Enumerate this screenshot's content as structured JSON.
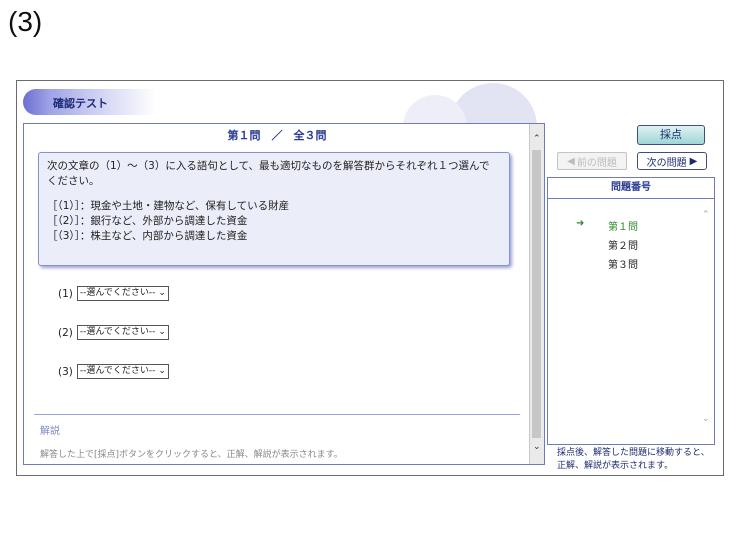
{
  "figure_label": "(3)",
  "header": {
    "title": "確認テスト"
  },
  "question": {
    "heading": "第１問　／　全３問",
    "prompt_line1": "次の文章の（1）～（3）に入る語句として、最も適切なものを解答群からそれぞれ１つ選んで",
    "prompt_line2": "ください。",
    "items": [
      "［（1）］：現金や土地・建物など、保有している財産",
      "［（2）］：銀行など、外部から調達した資金",
      "［（3）］：株主など、内部から調達した資金"
    ]
  },
  "answers": [
    {
      "label": "(1)",
      "value": "--選んでください--"
    },
    {
      "label": "(2)",
      "value": "--選んでください--"
    },
    {
      "label": "(3)",
      "value": "--選んでください--"
    }
  ],
  "explanation": {
    "title": "解説",
    "text": "解答した上で[採点]ボタンをクリックすると、正解、解説が表示されます。"
  },
  "toolbar": {
    "grade_label": "採点",
    "prev_label": "前の問題",
    "next_label": "次の問題"
  },
  "question_list": {
    "title": "問題番号",
    "items": [
      {
        "label": "第１問",
        "active": true
      },
      {
        "label": "第２問",
        "active": false
      },
      {
        "label": "第３問",
        "active": false
      }
    ]
  },
  "note": {
    "line1": "採点後、解答した問題に移動すると、",
    "line2": "正解、解説が表示されます。"
  },
  "colors": {
    "accent": "#2a3b91",
    "active_item": "#2e8b2e"
  }
}
